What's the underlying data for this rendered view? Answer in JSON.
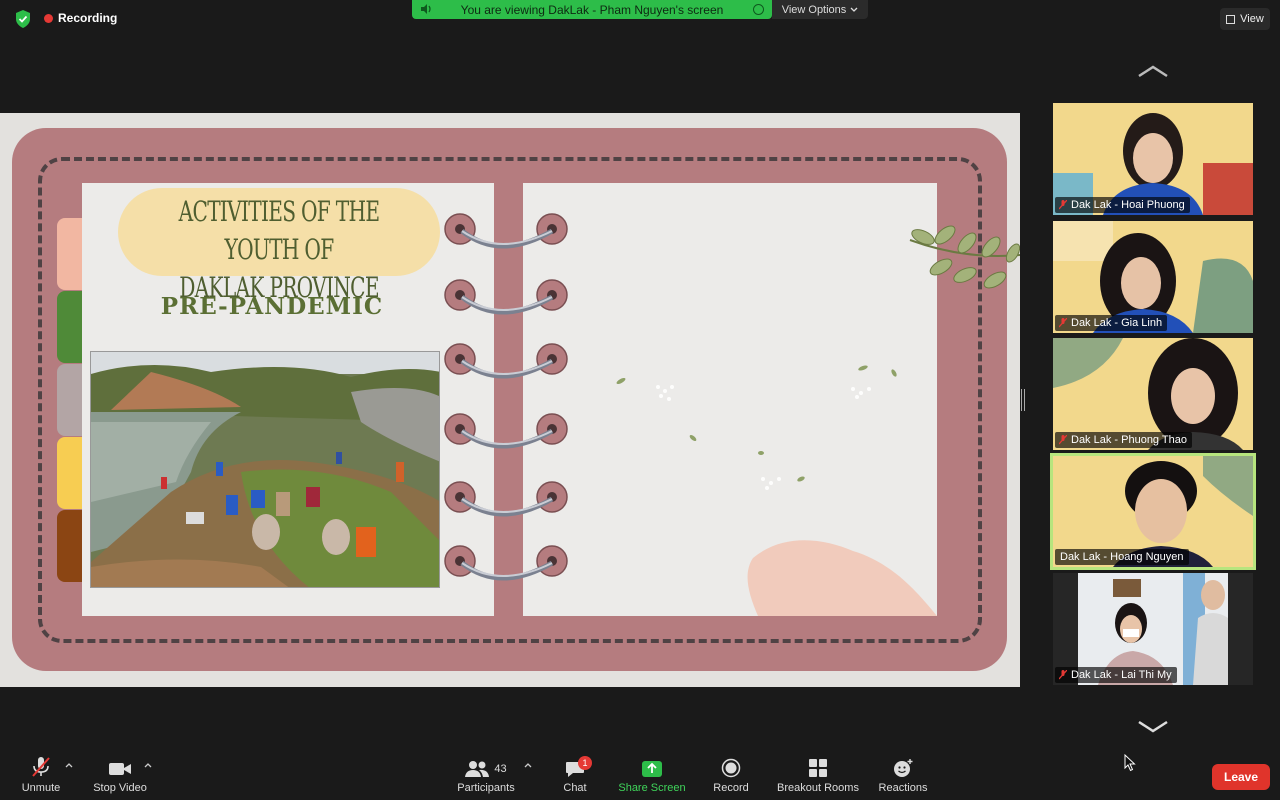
{
  "meeting": {
    "recording_label": "Recording",
    "banner_text": "You are viewing DakLak - Pham Nguyen's screen",
    "view_options_label": "View Options",
    "view_label": "View"
  },
  "slide": {
    "title_line1": "ACTIVITIES OF THE YOUTH OF",
    "title_line2": "DAKLAK PROVINCE",
    "subtitle": "PRE-PANDEMIC"
  },
  "participants_gallery": [
    {
      "name": "Dak Lak - Hoai Phuong",
      "muted": true,
      "active": false
    },
    {
      "name": "Dak Lak - Gia Linh",
      "muted": true,
      "active": false
    },
    {
      "name": "Dak Lak - Phuong Thao",
      "muted": true,
      "active": false
    },
    {
      "name": "Dak Lak - Hoang Nguyen",
      "muted": false,
      "active": true
    },
    {
      "name": "Dak Lak - Lai Thi My",
      "muted": true,
      "active": false
    }
  ],
  "toolbar": {
    "unmute_label": "Unmute",
    "stop_video_label": "Stop Video",
    "participants_label": "Participants",
    "participants_count": "43",
    "chat_label": "Chat",
    "chat_badge": "1",
    "share_screen_label": "Share Screen",
    "record_label": "Record",
    "breakout_label": "Breakout Rooms",
    "reactions_label": "Reactions",
    "leave_label": "Leave"
  },
  "colors": {
    "share_green": "#2dbd49",
    "leave_red": "#e0342b",
    "active_speaker": "#b7e57e",
    "book_frame": "#b57c7f"
  }
}
